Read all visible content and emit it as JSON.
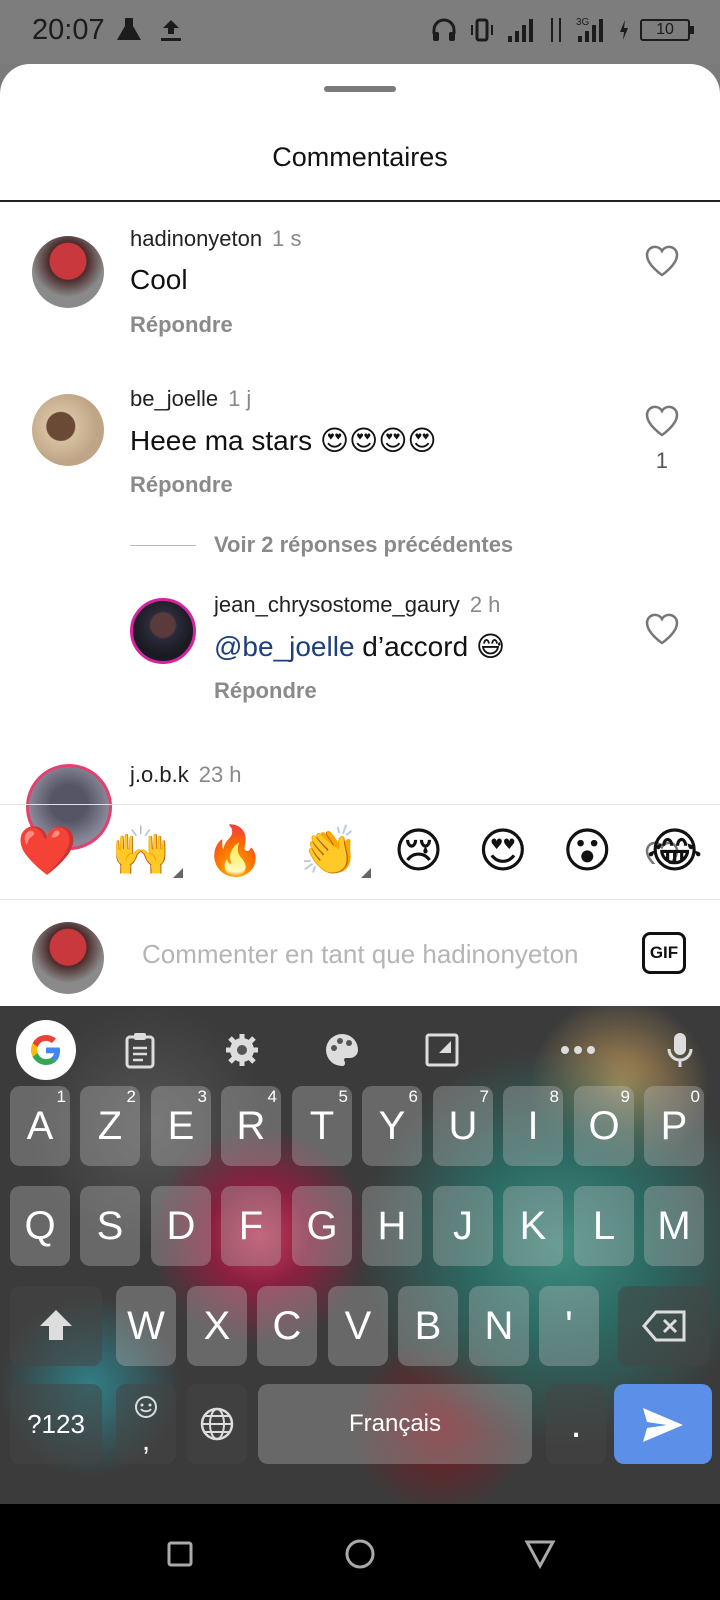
{
  "status": {
    "time": "20:07",
    "battery": "10",
    "network": "3G"
  },
  "sheet": {
    "title": "Commentaires"
  },
  "comments": [
    {
      "username": "hadinonyeton",
      "time": "1 s",
      "text": "Cool",
      "reply": "Répondre"
    },
    {
      "username": "be_joelle",
      "time": "1 j",
      "text": "Heee ma stars 😍😍😍😍",
      "reply": "Répondre",
      "likes": "1"
    },
    {
      "username": "jean_chrysostome_gaury",
      "time": "2 h",
      "mention": "@be_joelle",
      "text": " d’accord 😅",
      "reply": "Répondre"
    },
    {
      "username": "j.o.b.k",
      "time": "23 h"
    }
  ],
  "view_replies": "Voir 2 réponses précédentes",
  "reactions": [
    "❤️",
    "🙌",
    "🔥",
    "👏",
    "😢",
    "😍",
    "😮",
    "😂"
  ],
  "composer": {
    "placeholder": "Commenter en tant que hadinonyeton",
    "gif": "GIF"
  },
  "keyboard": {
    "row1": [
      [
        "A",
        "1"
      ],
      [
        "Z",
        "2"
      ],
      [
        "E",
        "3"
      ],
      [
        "R",
        "4"
      ],
      [
        "T",
        "5"
      ],
      [
        "Y",
        "6"
      ],
      [
        "U",
        "7"
      ],
      [
        "I",
        "8"
      ],
      [
        "O",
        "9"
      ],
      [
        "P",
        "0"
      ]
    ],
    "row2": [
      "Q",
      "S",
      "D",
      "F",
      "G",
      "H",
      "J",
      "K",
      "L",
      "M"
    ],
    "row3": [
      "W",
      "X",
      "C",
      "V",
      "B",
      "N",
      "'"
    ],
    "symbols": "?123",
    "comma": ",",
    "space": "Français",
    "period": "."
  }
}
